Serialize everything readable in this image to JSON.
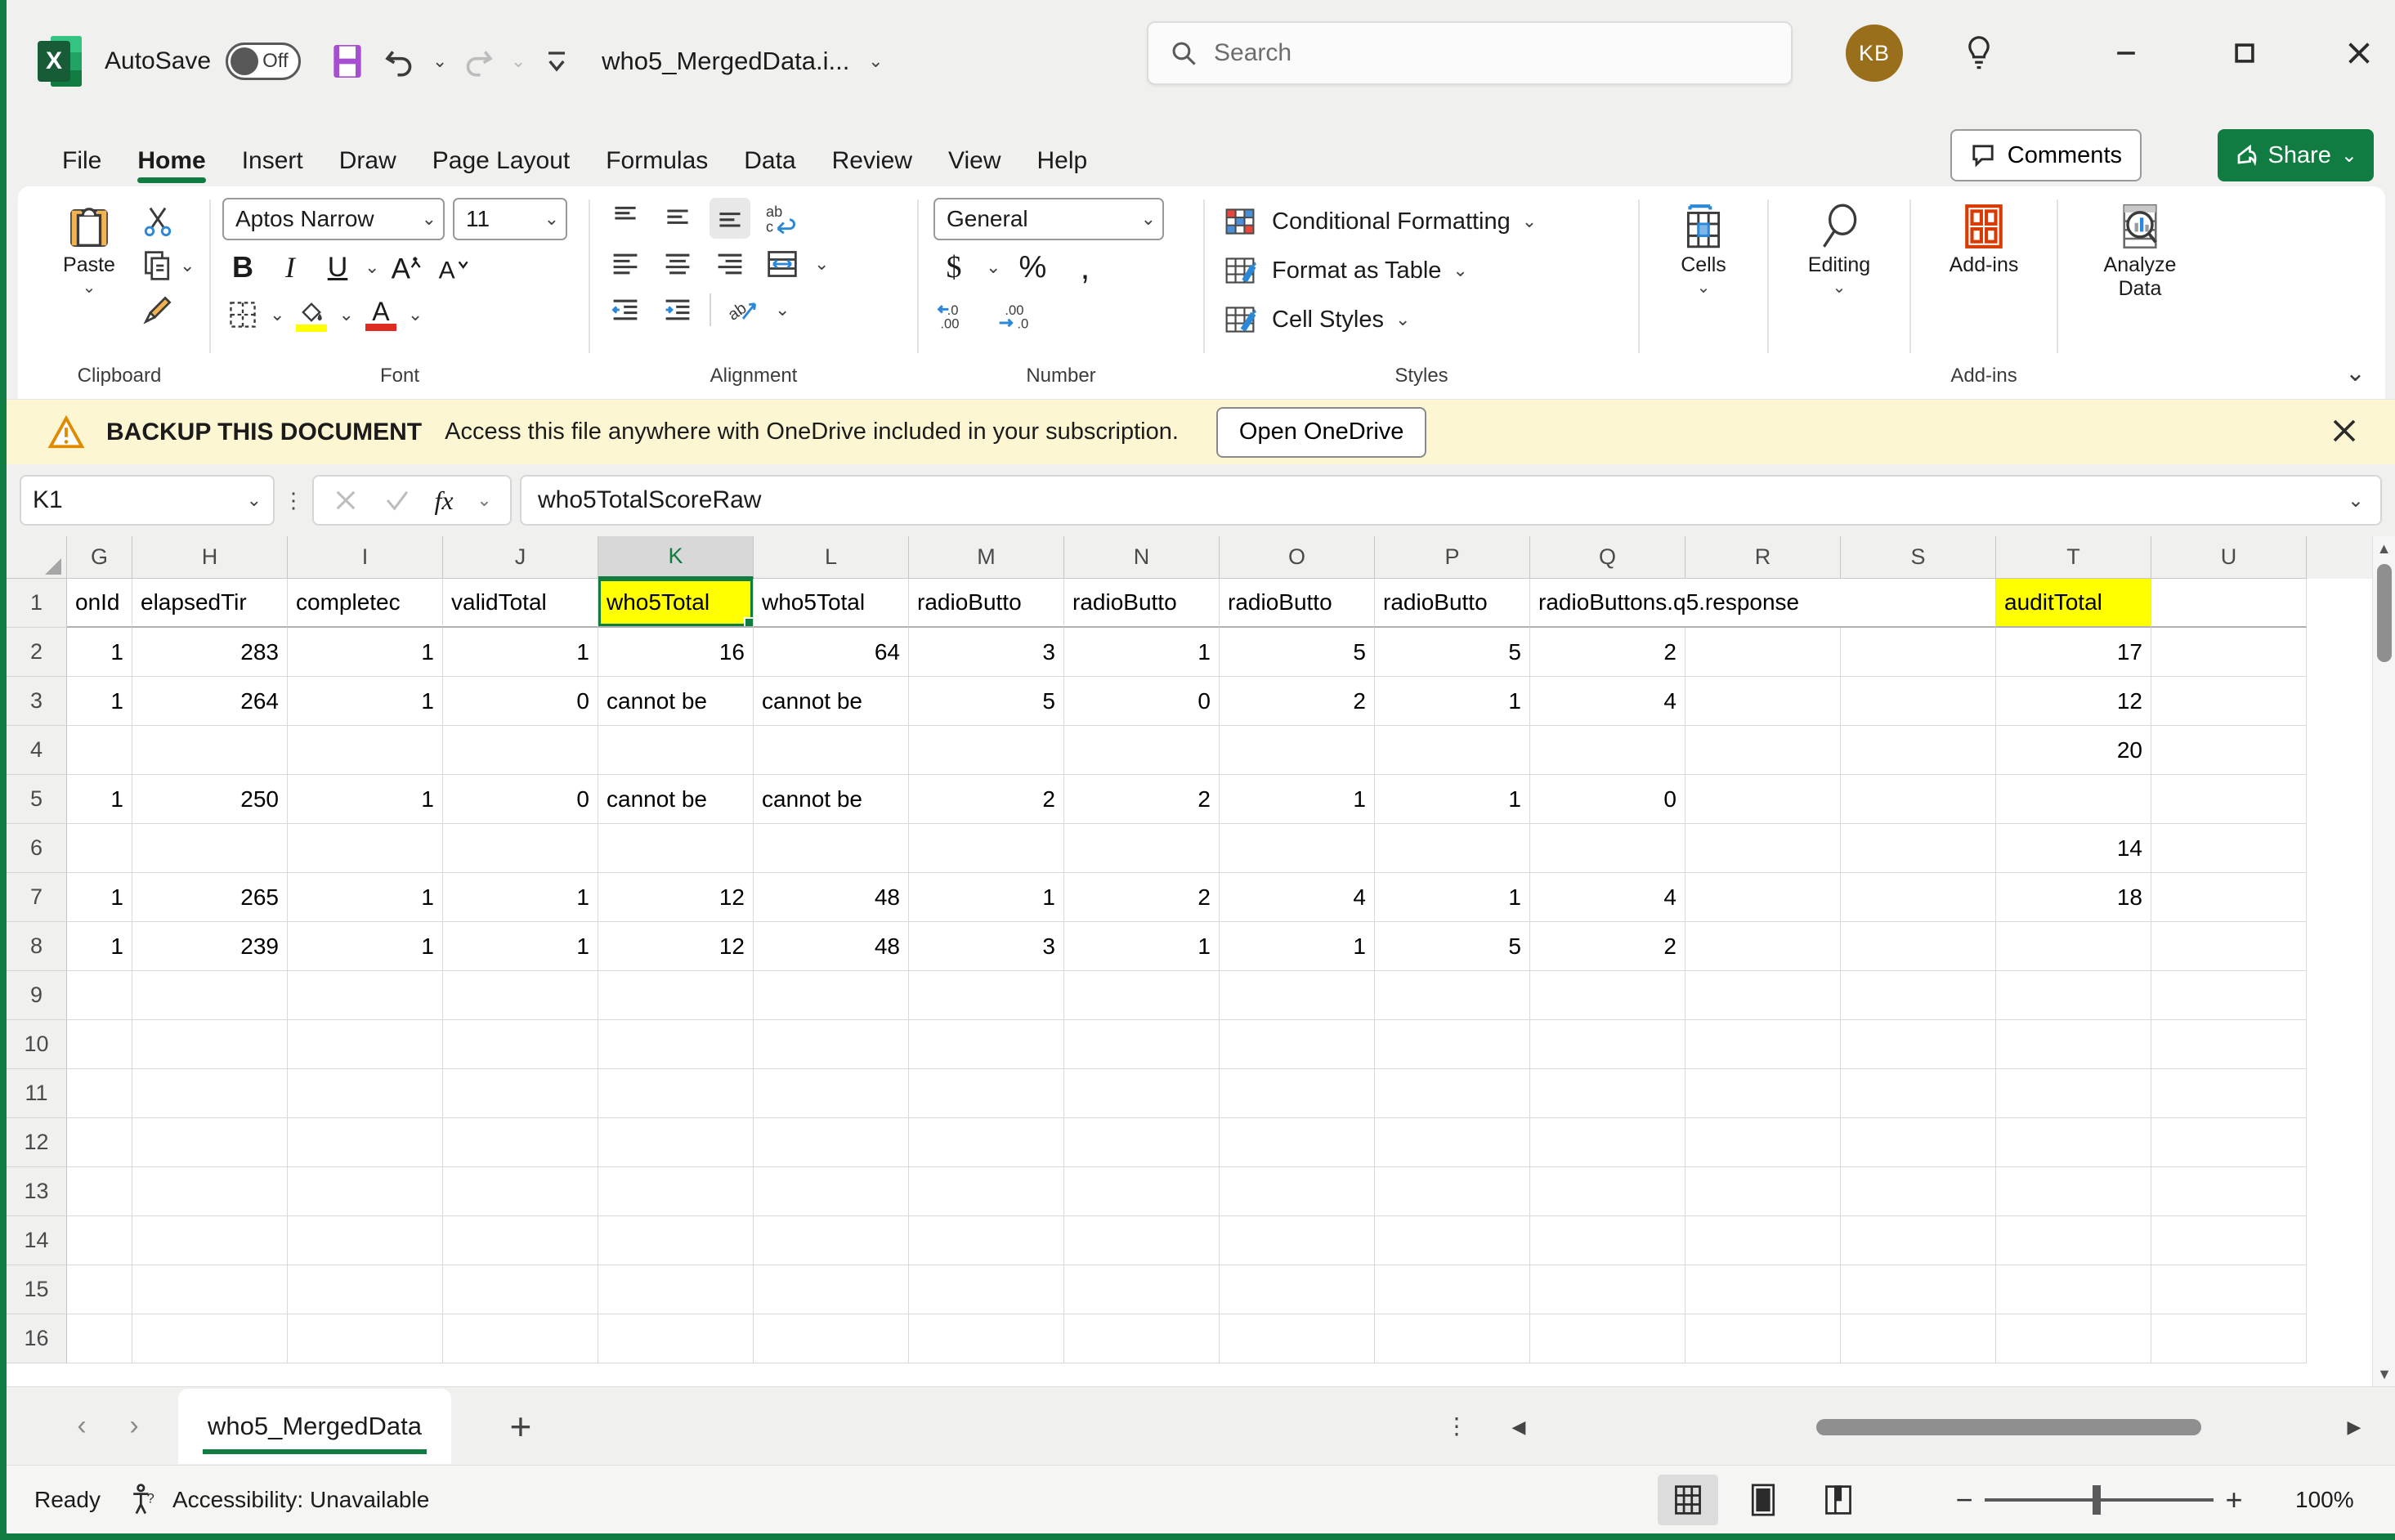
{
  "titlebar": {
    "autosave_label": "AutoSave",
    "autosave_state": "Off",
    "document_title": "who5_MergedData.i...",
    "save_icon": "save-icon",
    "undo_icon": "undo-icon",
    "redo_icon": "redo-icon",
    "customize_icon": "customize-quick-access-icon",
    "title_dropdown_icon": "chevron-down-icon"
  },
  "search": {
    "placeholder": "Search",
    "icon": "search-icon"
  },
  "account": {
    "initials": "KB"
  },
  "window": {
    "lightbulb_icon": "lightbulb-icon",
    "minimize_icon": "minimize-icon",
    "maximize_icon": "maximize-icon",
    "close_icon": "close-icon"
  },
  "ribbon_tabs": {
    "items": [
      {
        "label": "File",
        "active": false
      },
      {
        "label": "Home",
        "active": true
      },
      {
        "label": "Insert",
        "active": false
      },
      {
        "label": "Draw",
        "active": false
      },
      {
        "label": "Page Layout",
        "active": false
      },
      {
        "label": "Formulas",
        "active": false
      },
      {
        "label": "Data",
        "active": false
      },
      {
        "label": "Review",
        "active": false
      },
      {
        "label": "View",
        "active": false
      },
      {
        "label": "Help",
        "active": false
      }
    ],
    "comments_label": "Comments",
    "share_label": "Share"
  },
  "ribbon": {
    "clipboard": {
      "group_label": "Clipboard",
      "paste_label": "Paste",
      "cut_label": "Cut",
      "copy_label": "Copy",
      "format_painter_label": "Format Painter"
    },
    "font": {
      "group_label": "Font",
      "font_family": "Aptos Narrow",
      "font_size": "11",
      "bold_label": "B",
      "italic_label": "I",
      "underline_label": "U",
      "grow_font_label": "A",
      "shrink_font_label": "A",
      "borders_label": "Borders",
      "fill_color_label": "Fill Color",
      "font_color_label": "A"
    },
    "alignment": {
      "group_label": "Alignment",
      "wrap_text_label": "Wrap Text",
      "merge_center_label": "Merge & Center",
      "orientation_label": "Orientation"
    },
    "number": {
      "group_label": "Number",
      "format": "General",
      "currency_label": "$",
      "percent_label": "%",
      "comma_label": ",",
      "increase_decimal_label": "Increase Decimal",
      "decrease_decimal_label": "Decrease Decimal"
    },
    "styles": {
      "group_label": "Styles",
      "conditional_formatting": "Conditional Formatting",
      "format_as_table": "Format as Table",
      "cell_styles": "Cell Styles"
    },
    "cells": {
      "label": "Cells"
    },
    "editing": {
      "label": "Editing"
    },
    "addins": {
      "group_label": "Add-ins",
      "label": "Add-ins"
    },
    "analyze": {
      "label_line1": "Analyze",
      "label_line2": "Data"
    },
    "collapse_icon": "chevron-down-icon"
  },
  "notification": {
    "title": "BACKUP THIS DOCUMENT",
    "message": "Access this file anywhere with OneDrive included in your subscription.",
    "button": "Open OneDrive",
    "warning_icon": "warning-triangle-icon",
    "close_icon": "close-icon"
  },
  "formula_bar": {
    "name_box": "K1",
    "cancel_icon": "cancel-icon",
    "enter_icon": "confirm-check-icon",
    "fx_label": "fx",
    "formula_value": "who5TotalScoreRaw"
  },
  "grid": {
    "columns": [
      {
        "letter": "G",
        "width": 80,
        "selected": false
      },
      {
        "letter": "H",
        "width": 190,
        "selected": false
      },
      {
        "letter": "I",
        "width": 190,
        "selected": false
      },
      {
        "letter": "J",
        "width": 190,
        "selected": false
      },
      {
        "letter": "K",
        "width": 190,
        "selected": true
      },
      {
        "letter": "L",
        "width": 190,
        "selected": false
      },
      {
        "letter": "M",
        "width": 190,
        "selected": false
      },
      {
        "letter": "N",
        "width": 190,
        "selected": false
      },
      {
        "letter": "O",
        "width": 190,
        "selected": false
      },
      {
        "letter": "P",
        "width": 190,
        "selected": false
      },
      {
        "letter": "Q",
        "width": 190,
        "selected": false
      },
      {
        "letter": "R",
        "width": 190,
        "selected": false
      },
      {
        "letter": "S",
        "width": 190,
        "selected": false
      },
      {
        "letter": "T",
        "width": 190,
        "selected": false
      },
      {
        "letter": "U",
        "width": 190,
        "selected": false
      }
    ],
    "rows": [
      {
        "num": "1",
        "header_row": true,
        "cells": [
          {
            "v": "onId",
            "align": "txt"
          },
          {
            "v": "elapsedTir",
            "align": "txt"
          },
          {
            "v": "completec",
            "align": "txt"
          },
          {
            "v": "validTotal",
            "align": "txt"
          },
          {
            "v": "who5Total",
            "align": "txt",
            "highlight": true,
            "selected": true
          },
          {
            "v": "who5Total",
            "align": "txt"
          },
          {
            "v": "radioButto",
            "align": "txt"
          },
          {
            "v": "radioButto",
            "align": "txt"
          },
          {
            "v": "radioButto",
            "align": "txt"
          },
          {
            "v": "radioButto",
            "align": "txt"
          },
          {
            "v": "radioButtons.q5.response",
            "align": "txt",
            "span": 3
          },
          {
            "v": "auditTotal",
            "align": "txt",
            "highlight": true
          },
          {
            "v": "",
            "align": "txt"
          }
        ]
      },
      {
        "num": "2",
        "cells": [
          {
            "v": "1",
            "align": "num"
          },
          {
            "v": "283",
            "align": "num"
          },
          {
            "v": "1",
            "align": "num"
          },
          {
            "v": "1",
            "align": "num"
          },
          {
            "v": "16",
            "align": "num"
          },
          {
            "v": "64",
            "align": "num"
          },
          {
            "v": "3",
            "align": "num"
          },
          {
            "v": "1",
            "align": "num"
          },
          {
            "v": "5",
            "align": "num"
          },
          {
            "v": "5",
            "align": "num"
          },
          {
            "v": "2",
            "align": "num"
          },
          {
            "v": "",
            "align": "num"
          },
          {
            "v": "",
            "align": "num"
          },
          {
            "v": "17",
            "align": "num"
          },
          {
            "v": "",
            "align": "num"
          }
        ]
      },
      {
        "num": "3",
        "cells": [
          {
            "v": "1",
            "align": "num"
          },
          {
            "v": "264",
            "align": "num"
          },
          {
            "v": "1",
            "align": "num"
          },
          {
            "v": "0",
            "align": "num"
          },
          {
            "v": "cannot be",
            "align": "txt"
          },
          {
            "v": "cannot be",
            "align": "txt"
          },
          {
            "v": "5",
            "align": "num"
          },
          {
            "v": "0",
            "align": "num"
          },
          {
            "v": "2",
            "align": "num"
          },
          {
            "v": "1",
            "align": "num"
          },
          {
            "v": "4",
            "align": "num"
          },
          {
            "v": "",
            "align": "num"
          },
          {
            "v": "",
            "align": "num"
          },
          {
            "v": "12",
            "align": "num"
          },
          {
            "v": "",
            "align": "num"
          }
        ]
      },
      {
        "num": "4",
        "cells": [
          {
            "v": "",
            "align": "num"
          },
          {
            "v": "",
            "align": "num"
          },
          {
            "v": "",
            "align": "num"
          },
          {
            "v": "",
            "align": "num"
          },
          {
            "v": "",
            "align": "num"
          },
          {
            "v": "",
            "align": "num"
          },
          {
            "v": "",
            "align": "num"
          },
          {
            "v": "",
            "align": "num"
          },
          {
            "v": "",
            "align": "num"
          },
          {
            "v": "",
            "align": "num"
          },
          {
            "v": "",
            "align": "num"
          },
          {
            "v": "",
            "align": "num"
          },
          {
            "v": "",
            "align": "num"
          },
          {
            "v": "20",
            "align": "num"
          },
          {
            "v": "",
            "align": "num"
          }
        ]
      },
      {
        "num": "5",
        "cells": [
          {
            "v": "1",
            "align": "num"
          },
          {
            "v": "250",
            "align": "num"
          },
          {
            "v": "1",
            "align": "num"
          },
          {
            "v": "0",
            "align": "num"
          },
          {
            "v": "cannot be",
            "align": "txt"
          },
          {
            "v": "cannot be",
            "align": "txt"
          },
          {
            "v": "2",
            "align": "num"
          },
          {
            "v": "2",
            "align": "num"
          },
          {
            "v": "1",
            "align": "num"
          },
          {
            "v": "1",
            "align": "num"
          },
          {
            "v": "0",
            "align": "num"
          },
          {
            "v": "",
            "align": "num"
          },
          {
            "v": "",
            "align": "num"
          },
          {
            "v": "",
            "align": "num"
          },
          {
            "v": "",
            "align": "num"
          }
        ]
      },
      {
        "num": "6",
        "cells": [
          {
            "v": "",
            "align": "num"
          },
          {
            "v": "",
            "align": "num"
          },
          {
            "v": "",
            "align": "num"
          },
          {
            "v": "",
            "align": "num"
          },
          {
            "v": "",
            "align": "num"
          },
          {
            "v": "",
            "align": "num"
          },
          {
            "v": "",
            "align": "num"
          },
          {
            "v": "",
            "align": "num"
          },
          {
            "v": "",
            "align": "num"
          },
          {
            "v": "",
            "align": "num"
          },
          {
            "v": "",
            "align": "num"
          },
          {
            "v": "",
            "align": "num"
          },
          {
            "v": "",
            "align": "num"
          },
          {
            "v": "14",
            "align": "num"
          },
          {
            "v": "",
            "align": "num"
          }
        ]
      },
      {
        "num": "7",
        "cells": [
          {
            "v": "1",
            "align": "num"
          },
          {
            "v": "265",
            "align": "num"
          },
          {
            "v": "1",
            "align": "num"
          },
          {
            "v": "1",
            "align": "num"
          },
          {
            "v": "12",
            "align": "num"
          },
          {
            "v": "48",
            "align": "num"
          },
          {
            "v": "1",
            "align": "num"
          },
          {
            "v": "2",
            "align": "num"
          },
          {
            "v": "4",
            "align": "num"
          },
          {
            "v": "1",
            "align": "num"
          },
          {
            "v": "4",
            "align": "num"
          },
          {
            "v": "",
            "align": "num"
          },
          {
            "v": "",
            "align": "num"
          },
          {
            "v": "18",
            "align": "num"
          },
          {
            "v": "",
            "align": "num"
          }
        ]
      },
      {
        "num": "8",
        "cells": [
          {
            "v": "1",
            "align": "num"
          },
          {
            "v": "239",
            "align": "num"
          },
          {
            "v": "1",
            "align": "num"
          },
          {
            "v": "1",
            "align": "num"
          },
          {
            "v": "12",
            "align": "num"
          },
          {
            "v": "48",
            "align": "num"
          },
          {
            "v": "3",
            "align": "num"
          },
          {
            "v": "1",
            "align": "num"
          },
          {
            "v": "1",
            "align": "num"
          },
          {
            "v": "5",
            "align": "num"
          },
          {
            "v": "2",
            "align": "num"
          },
          {
            "v": "",
            "align": "num"
          },
          {
            "v": "",
            "align": "num"
          },
          {
            "v": "",
            "align": "num"
          },
          {
            "v": "",
            "align": "num"
          }
        ]
      },
      {
        "num": "9",
        "cells": []
      },
      {
        "num": "10",
        "cells": []
      },
      {
        "num": "11",
        "cells": []
      },
      {
        "num": "12",
        "cells": []
      },
      {
        "num": "13",
        "cells": []
      },
      {
        "num": "14",
        "cells": []
      },
      {
        "num": "15",
        "cells": []
      },
      {
        "num": "16",
        "cells": []
      }
    ]
  },
  "sheet_bar": {
    "prev_icon": "chevron-left-icon",
    "next_icon": "chevron-right-icon",
    "tabs": [
      {
        "name": "who5_MergedData",
        "active": true
      }
    ],
    "add_sheet_label": "+"
  },
  "status_bar": {
    "ready": "Ready",
    "accessibility": "Accessibility: Unavailable",
    "accessibility_icon": "accessibility-icon",
    "view_normal_icon": "normal-view-icon",
    "view_pagelayout_icon": "page-layout-view-icon",
    "view_pagebreak_icon": "page-break-view-icon",
    "zoom_out_label": "−",
    "zoom_in_label": "+",
    "zoom_level": "100%"
  },
  "colors": {
    "excel_green": "#107c41",
    "highlight_yellow": "#ffff00",
    "notification_bg": "#fdf6d3",
    "avatar_bg": "#996f1b"
  }
}
